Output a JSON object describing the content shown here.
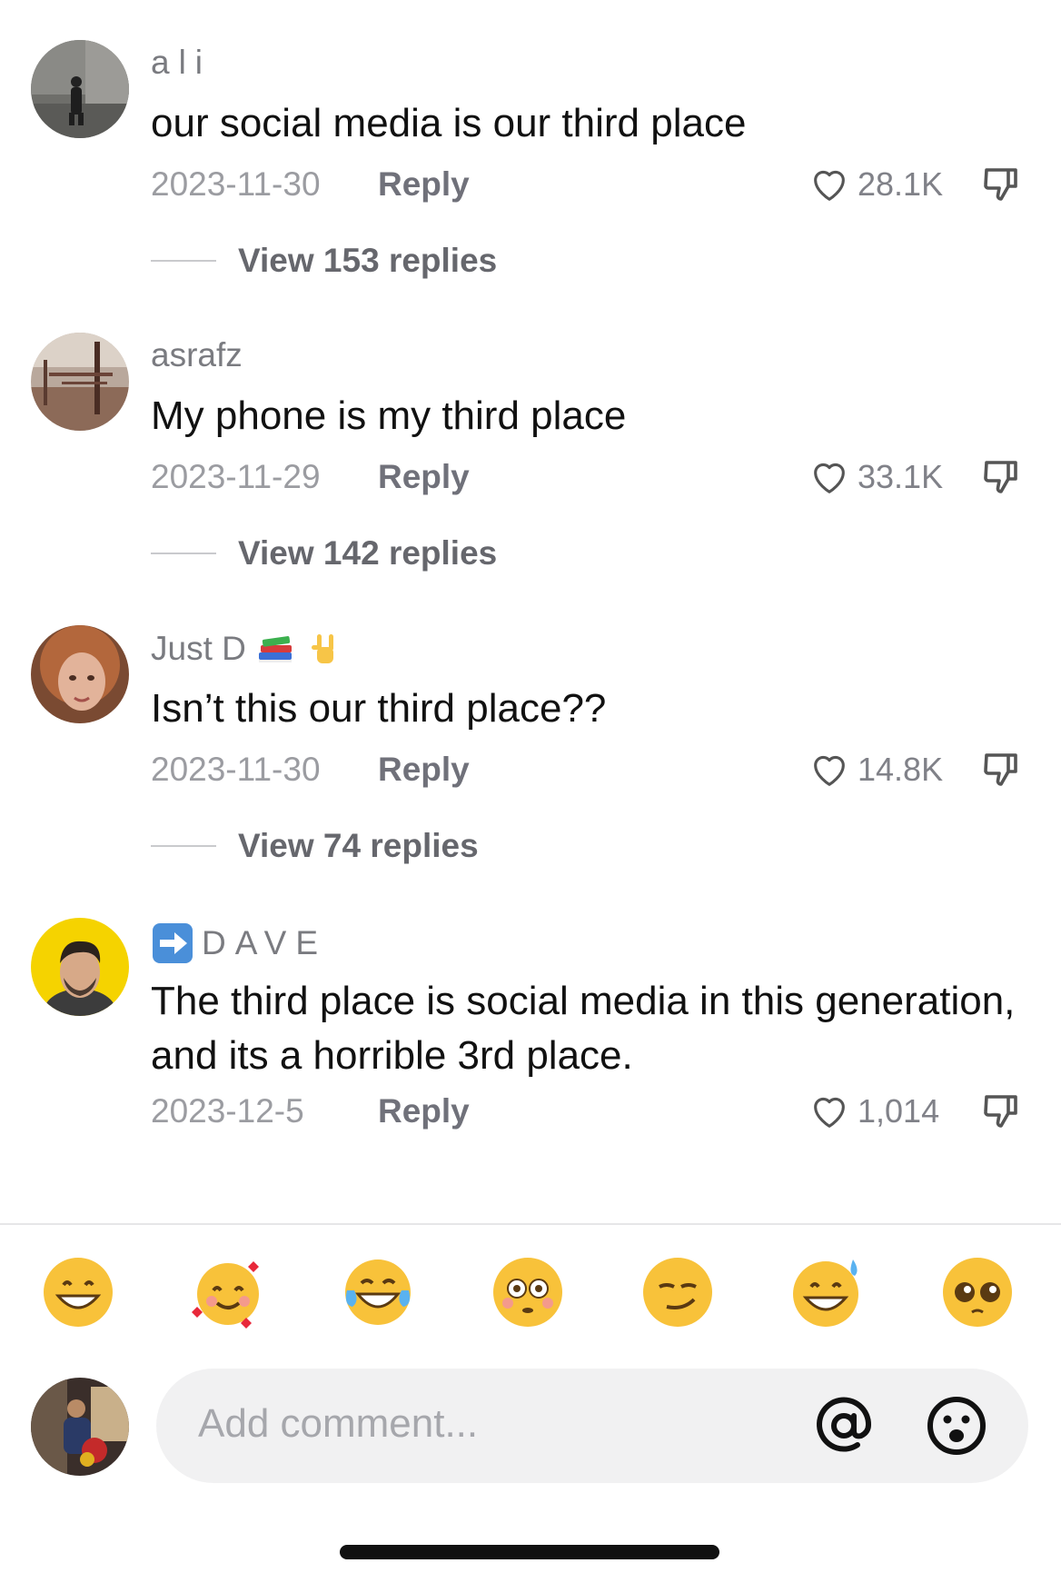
{
  "comments": [
    {
      "username": "ali",
      "text": "our social media is our third place",
      "date": "2023-11-30",
      "reply_label": "Reply",
      "likes": "28.1K",
      "view_replies": "View 153 replies"
    },
    {
      "username": "asrafz",
      "text": "My phone is my third place",
      "date": "2023-11-29",
      "reply_label": "Reply",
      "likes": "33.1K",
      "view_replies": "View 142 replies"
    },
    {
      "username": "Just D",
      "username_emojis": [
        "books-emoji",
        "rock-on-hand-emoji"
      ],
      "text": "Isn’t this our third place??",
      "date": "2023-11-30",
      "reply_label": "Reply",
      "likes": "14.8K",
      "view_replies": "View 74 replies"
    },
    {
      "username": "DAVE",
      "username_prefix_icon": "right-arrow-emoji",
      "text": "The third place is social media in this generation, and its a horrible 3rd place.",
      "date": "2023-12-5",
      "reply_label": "Reply",
      "likes": "1,014"
    }
  ],
  "emoji_bar": [
    "grinning-face",
    "smiling-face-with-hearts",
    "face-with-tears-of-joy",
    "flushed-face",
    "smirking-face",
    "grinning-face-with-sweat",
    "pleading-face"
  ],
  "composer": {
    "placeholder": "Add comment...",
    "icons": [
      "at-icon",
      "emoji-face-icon"
    ]
  },
  "colors": {
    "username": "#7a7b80",
    "meta": "#9b9ca1",
    "input_bg": "#f1f1f2"
  }
}
